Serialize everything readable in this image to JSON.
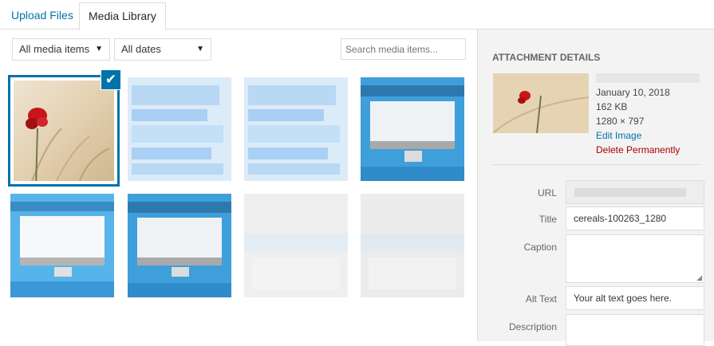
{
  "tabs": {
    "upload": "Upload Files",
    "library": "Media Library"
  },
  "filters": {
    "type": {
      "selected": "All media items"
    },
    "date": {
      "selected": "All dates"
    },
    "search": {
      "placeholder": "Search media items..."
    }
  },
  "grid": {
    "items": [
      {
        "kind": "photo",
        "selected": true
      },
      {
        "kind": "doc-light",
        "selected": false
      },
      {
        "kind": "doc-light",
        "selected": false
      },
      {
        "kind": "monitor-dark",
        "selected": false
      },
      {
        "kind": "monitor",
        "selected": false
      },
      {
        "kind": "monitor-dark",
        "selected": false
      },
      {
        "kind": "blank-gray",
        "selected": false
      },
      {
        "kind": "blank-gray",
        "selected": false
      }
    ],
    "check_icon": "checkmark-icon"
  },
  "details": {
    "heading": "ATTACHMENT DETAILS",
    "date": "January 10, 2018",
    "size": "162 KB",
    "dimensions": "1280 × 797",
    "edit_link": "Edit Image",
    "delete_link": "Delete Permanently",
    "fields": {
      "url_label": "URL",
      "title_label": "Title",
      "title_value": "cereals-100263_1280",
      "caption_label": "Caption",
      "alt_label": "Alt Text",
      "alt_value": "Your alt text goes here.",
      "description_label": "Description"
    }
  },
  "colors": {
    "accent": "#0073aa",
    "delete": "#aa0000",
    "sidebar_bg": "#f3f3f3"
  }
}
